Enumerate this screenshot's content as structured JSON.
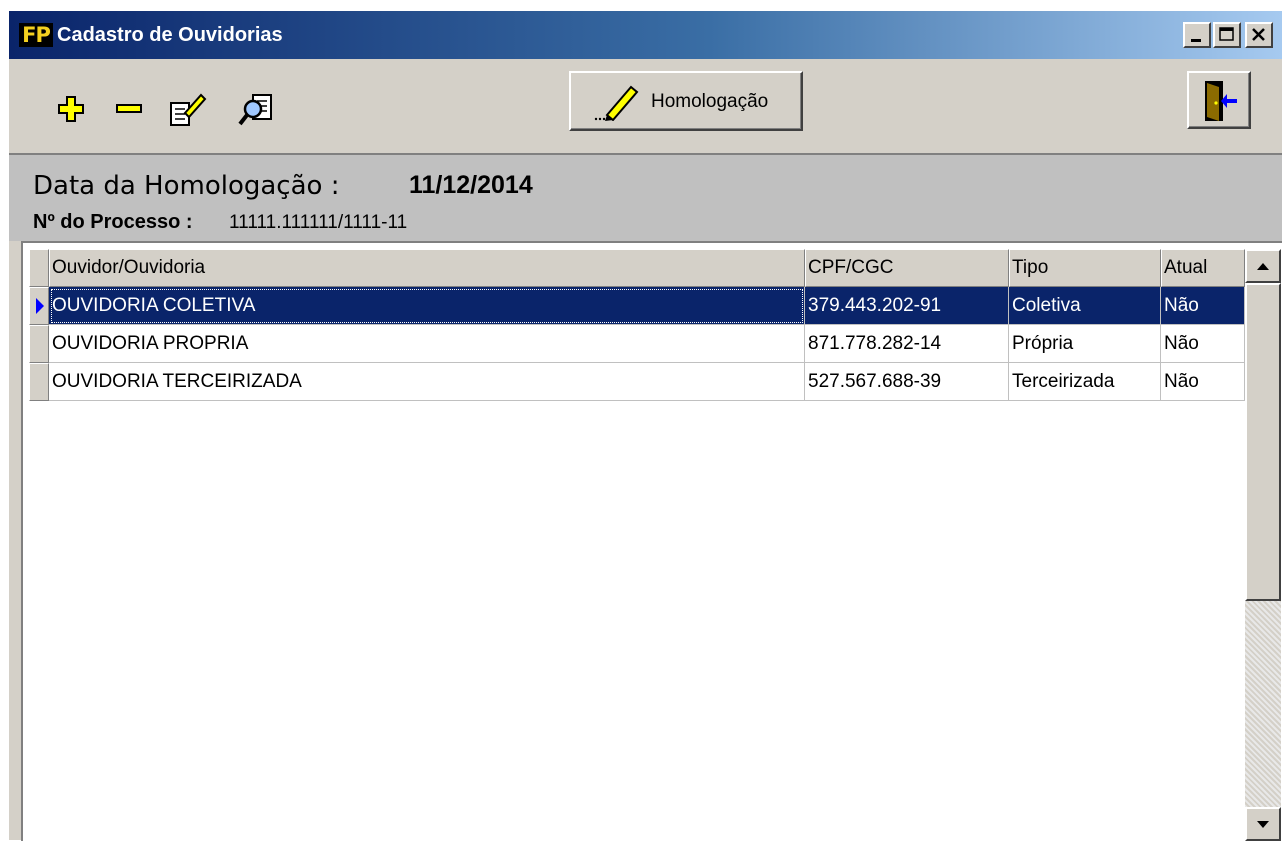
{
  "window": {
    "title": "Cadastro de Ouvidorias",
    "logo_text": "FP",
    "controls": [
      "minimize-icon",
      "maximize-icon",
      "close-icon"
    ]
  },
  "toolbar": {
    "icons": [
      "add-icon",
      "remove-icon",
      "edit-icon",
      "search-icon"
    ],
    "homolog_label": "Homologação",
    "exit_icon": "exit-door-icon"
  },
  "info": {
    "date_label": "Data da Homologação :",
    "date_value": "11/12/2014",
    "process_label": "Nº do Processo :",
    "process_value": "11111.111111/1111-11"
  },
  "grid": {
    "columns": [
      "Ouvidor/Ouvidoria",
      "CPF/CGC",
      "Tipo",
      "Atual"
    ],
    "rows": [
      {
        "name": "OUVIDORIA COLETIVA",
        "cpf": "379.443.202-91",
        "tipo": "Coletiva",
        "atual": "Não",
        "selected": true
      },
      {
        "name": "OUVIDORIA PROPRIA",
        "cpf": "871.778.282-14",
        "tipo": "Própria",
        "atual": "Não",
        "selected": false
      },
      {
        "name": "OUVIDORIA TERCEIRIZADA",
        "cpf": "527.567.688-39",
        "tipo": "Terceirizada",
        "atual": "Não",
        "selected": false
      }
    ]
  },
  "colors": {
    "title_start": "#0a246a",
    "title_end": "#a6caf0",
    "selection": "#0a246a",
    "face": "#d4d0c8"
  }
}
